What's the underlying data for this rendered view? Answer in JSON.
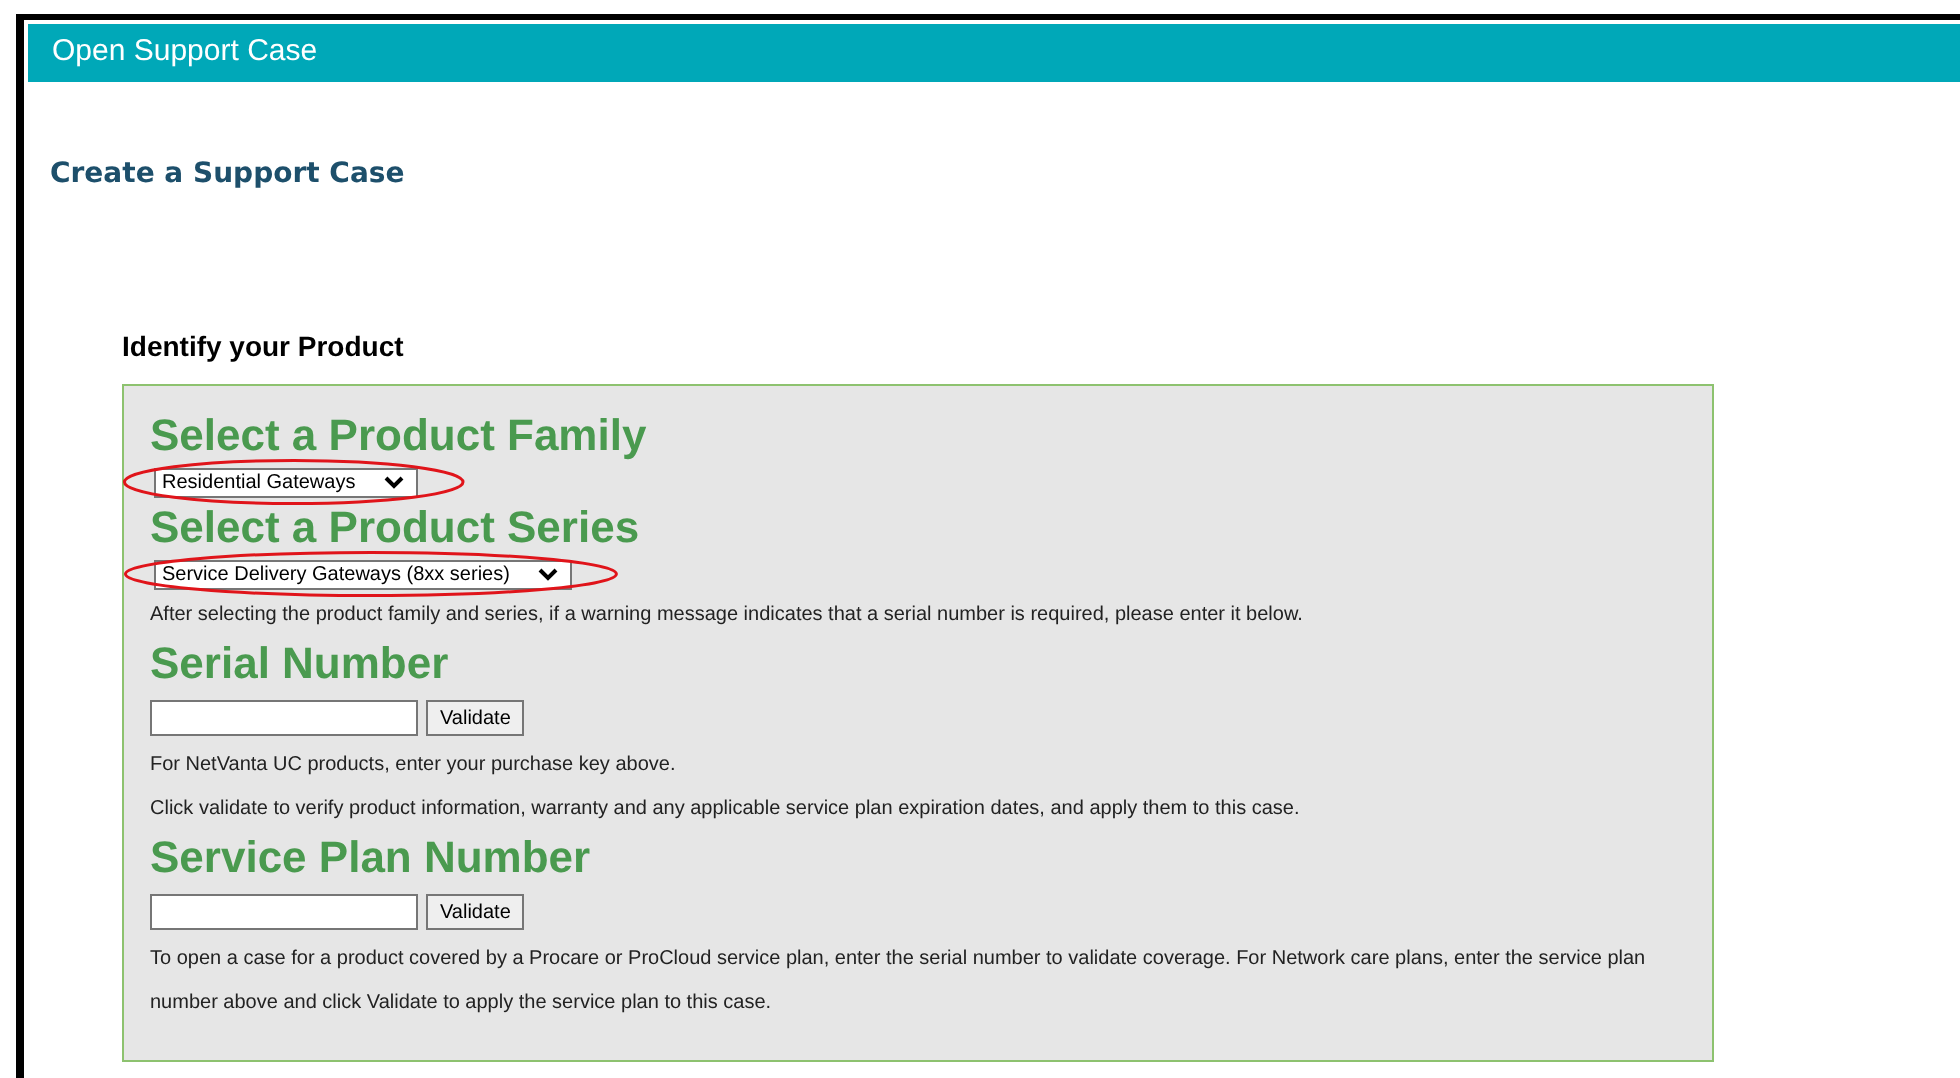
{
  "panel": {
    "title": "Open Support Case"
  },
  "page_title": "Create a Support Case",
  "section_title": "Identify your Product",
  "form": [
    {
      "kind": "heading",
      "text": "Select a Product Family"
    },
    {
      "kind": "select",
      "value": "Residential Gateways",
      "highlighted": true
    },
    {
      "kind": "heading",
      "text": "Select a Product Series"
    },
    {
      "kind": "select",
      "value": "Service Delivery Gateways (8xx series)",
      "highlighted": true
    },
    {
      "kind": "note",
      "text": "After selecting the product family and series, if a warning message indicates that a serial number is required, please enter it below."
    },
    {
      "kind": "heading",
      "text": "Serial Number"
    },
    {
      "kind": "validate",
      "button": "Validate"
    },
    {
      "kind": "note",
      "text": "For NetVanta UC products, enter your purchase key above."
    },
    {
      "kind": "note",
      "text": "Click validate to verify product information, warranty and any applicable service plan expiration dates, and apply them to this case."
    },
    {
      "kind": "heading",
      "text": "Service Plan Number"
    },
    {
      "kind": "validate",
      "button": "Validate"
    },
    {
      "kind": "note",
      "text": "To open a case for a product covered by a Procare or ProCloud service plan, enter the serial number to validate coverage. For Network care plans, enter the service plan number above and click Validate to apply the service plan to this case."
    }
  ]
}
